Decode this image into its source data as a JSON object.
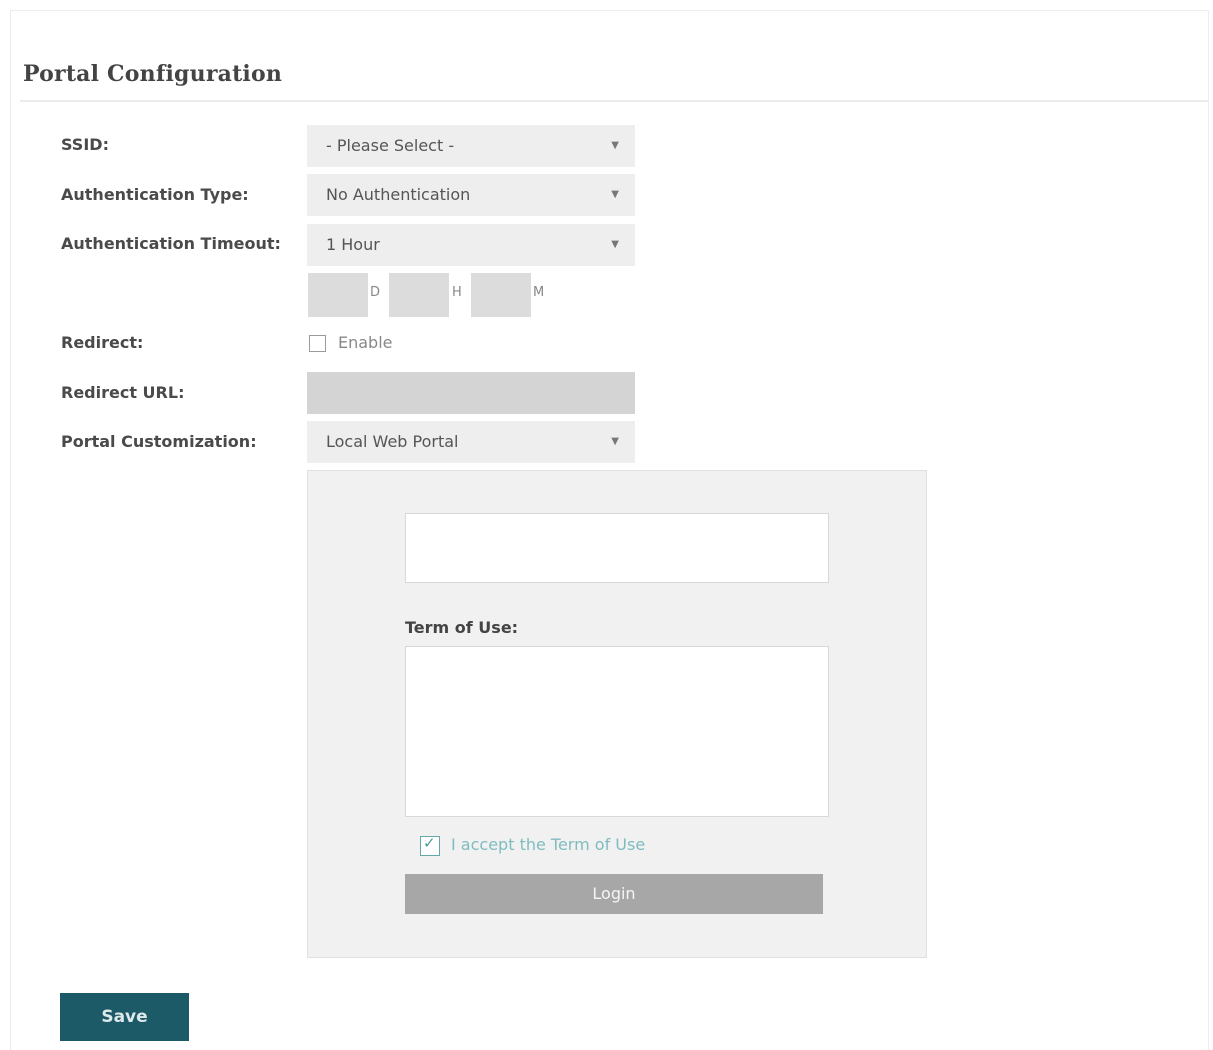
{
  "page_title": "Portal Configuration",
  "form": {
    "ssid": {
      "label": "SSID:",
      "value": "- Please Select -"
    },
    "auth_type": {
      "label": "Authentication Type:",
      "value": "No Authentication"
    },
    "auth_timeout": {
      "label": "Authentication Timeout:",
      "value": "1 Hour",
      "custom": {
        "d_unit": "D",
        "h_unit": "H",
        "m_unit": "M"
      }
    },
    "redirect": {
      "label": "Redirect:",
      "checkbox_label": "Enable",
      "checked": false
    },
    "redirect_url": {
      "label": "Redirect URL:",
      "value": ""
    },
    "portal_customization": {
      "label": "Portal Customization:",
      "value": "Local Web Portal"
    }
  },
  "preview": {
    "term_of_use_label": "Term of Use:",
    "accept_label": "I accept the Term of Use",
    "accept_checked": true,
    "login_label": "Login"
  },
  "save_label": "Save",
  "icons": {
    "dropdown": "caret-down-icon",
    "check": "check-icon"
  },
  "colors": {
    "save_button": "#1d5a68",
    "accept_text": "#7fbcbf",
    "login_button": "#a7a7a7"
  }
}
